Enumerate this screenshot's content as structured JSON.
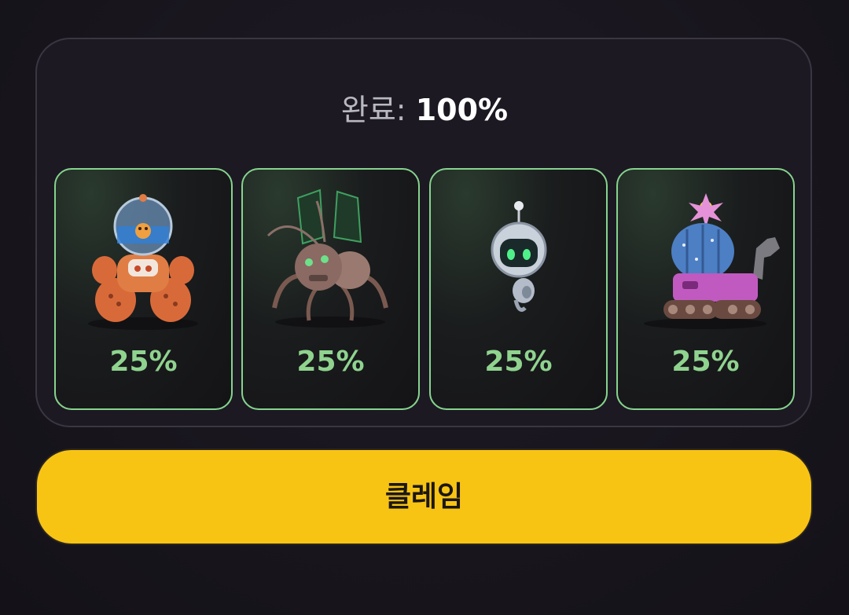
{
  "progress": {
    "label": "완료:",
    "value_text": "100%",
    "value": 100
  },
  "cards": [
    {
      "name": "diver-mech",
      "percent_text": "25%",
      "percent": 25
    },
    {
      "name": "mech-ant",
      "percent_text": "25%",
      "percent": 25
    },
    {
      "name": "floating-droid",
      "percent_text": "25%",
      "percent": 25
    },
    {
      "name": "cactus-tank",
      "percent_text": "25%",
      "percent": 25
    }
  ],
  "claim_button": {
    "label": "클레임"
  },
  "colors": {
    "accent": "#f8c414",
    "card_border": "#86d48e",
    "percent_text": "#8fd38f",
    "background": "#18151d"
  }
}
